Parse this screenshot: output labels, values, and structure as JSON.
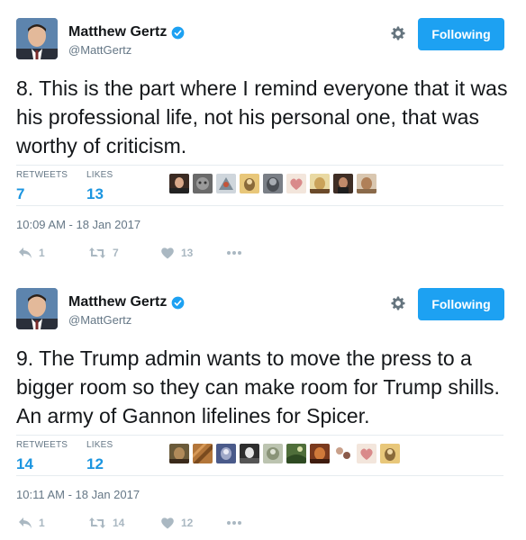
{
  "tweets": [
    {
      "user": {
        "name": "Matthew Gertz",
        "handle": "@MattGertz"
      },
      "follow_label": "Following",
      "text": "8. This is the part where I remind everyone that it was his professional life, not his personal one, that was worthy of criticism.",
      "stats": {
        "retweets_label": "RETWEETS",
        "retweets": "7",
        "likes_label": "LIKES",
        "likes": "13"
      },
      "liker_count": 9,
      "timestamp": "10:09 AM - 18 Jan 2017",
      "actions": {
        "reply": "1",
        "retweet": "7",
        "like": "13"
      }
    },
    {
      "user": {
        "name": "Matthew Gertz",
        "handle": "@MattGertz"
      },
      "follow_label": "Following",
      "text": "9. The Trump admin wants to move the press to a bigger room so they can make room for Trump shills. An army of Gannon lifelines for Spicer.",
      "stats": {
        "retweets_label": "RETWEETS",
        "retweets": "14",
        "likes_label": "LIKES",
        "likes": "12"
      },
      "liker_count": 9,
      "timestamp": "10:11 AM - 18 Jan 2017",
      "actions": {
        "reply": "1",
        "retweet": "14",
        "like": "12"
      }
    }
  ],
  "icons": {
    "verified": "verified-badge-icon",
    "gear": "gear-icon",
    "reply": "reply-icon",
    "retweet": "retweet-icon",
    "like": "heart-icon",
    "more": "more-dots-icon"
  },
  "colors": {
    "accent": "#1da1f2",
    "stat_value": "#1b95e0",
    "muted": "#657786",
    "action_icon": "#aab8c2"
  }
}
